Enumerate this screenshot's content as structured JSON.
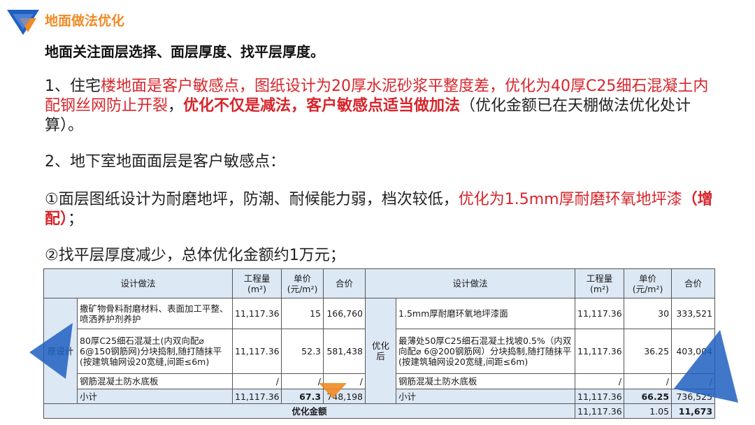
{
  "header": {
    "title": "地面做法优化",
    "headline": "地面关注面层选择、面层厚度、找平层厚度。"
  },
  "paragraphs": {
    "p1": {
      "prefix": "1、住宅",
      "red1": "楼地面是客户敏感点，图纸设计为20厚水泥砂浆平整度差，优化为40厚C25细石混凝土内配钢丝网防止开裂",
      "sep": "，",
      "redbold": "优化不仅是减法，客户敏感点适当做加法",
      "suffix": "（优化金额已在天棚做法优化处计算）。"
    },
    "p2": "2、地下室地面面层是客户敏感点：",
    "p3": {
      "prefix": "①面层图纸设计为耐磨地坪，防潮、耐候能力弱，档次较低，",
      "red": "优化为1.5mm厚耐磨环氧地坪漆",
      "redbold": "（增配）",
      "suffix": "；"
    },
    "p4": "②找平层厚度减少，总体优化金额约1万元；"
  },
  "table": {
    "headers": {
      "design_method": "设计做法",
      "quantity": "工程量",
      "quantity_unit": "(m²)",
      "unit_price": "单价",
      "unit_price_unit": "(元/m²)",
      "total": "合价"
    },
    "orig_label": "原设计",
    "opt_label": "优化后",
    "rows": [
      {
        "orig_desc": "撒矿物骨料耐磨材料、表面加工平整、喷洒养护剂养护",
        "orig_qty": "11,117.36",
        "orig_price": "15",
        "orig_total": "166,760",
        "opt_desc": "1.5mm厚耐磨环氧地坪漆面",
        "opt_qty": "11,117.36",
        "opt_price": "30",
        "opt_total": "333,521"
      },
      {
        "orig_desc": "80厚C25细石混凝土(内双向配⌀ 6@150钢筋网)分块捣制,随打随抹平(按建筑轴网设20宽缝,间距≤6m)",
        "orig_qty": "11,117.36",
        "orig_price": "52.3",
        "orig_total": "581,438",
        "opt_desc": "最薄处50厚C25细石混凝土找坡0.5%（内双向配⌀ 6@200钢筋网）分块捣制,随打随抹平(按建筑轴网设20宽缝,间距≤6m)",
        "opt_qty": "11,117.36",
        "opt_price": "36.25",
        "opt_total": "403,004"
      },
      {
        "orig_desc": "钢筋混凝土防水底板",
        "orig_qty": "/",
        "orig_price": "/",
        "orig_total": "/",
        "opt_desc": "钢筋混凝土防水底板",
        "opt_qty": "/",
        "opt_price": "/",
        "opt_total": "/"
      }
    ],
    "subtotal": {
      "orig_label": "小计",
      "orig_qty": "11,117.36",
      "orig_price": "67.3",
      "orig_total": "748,198",
      "opt_label": "小计",
      "opt_qty": "11,117.36",
      "opt_price": "66.25",
      "opt_total": "736,525"
    },
    "optimization": {
      "label": "优化金额",
      "qty": "11,117.36",
      "price": "1.05",
      "total": "11,673"
    }
  },
  "colors": {
    "accent_orange": "#f08a24",
    "accent_blue": "#1f5fbf",
    "highlight_red": "#d6252b",
    "table_header_bg": "#dde8f5"
  }
}
